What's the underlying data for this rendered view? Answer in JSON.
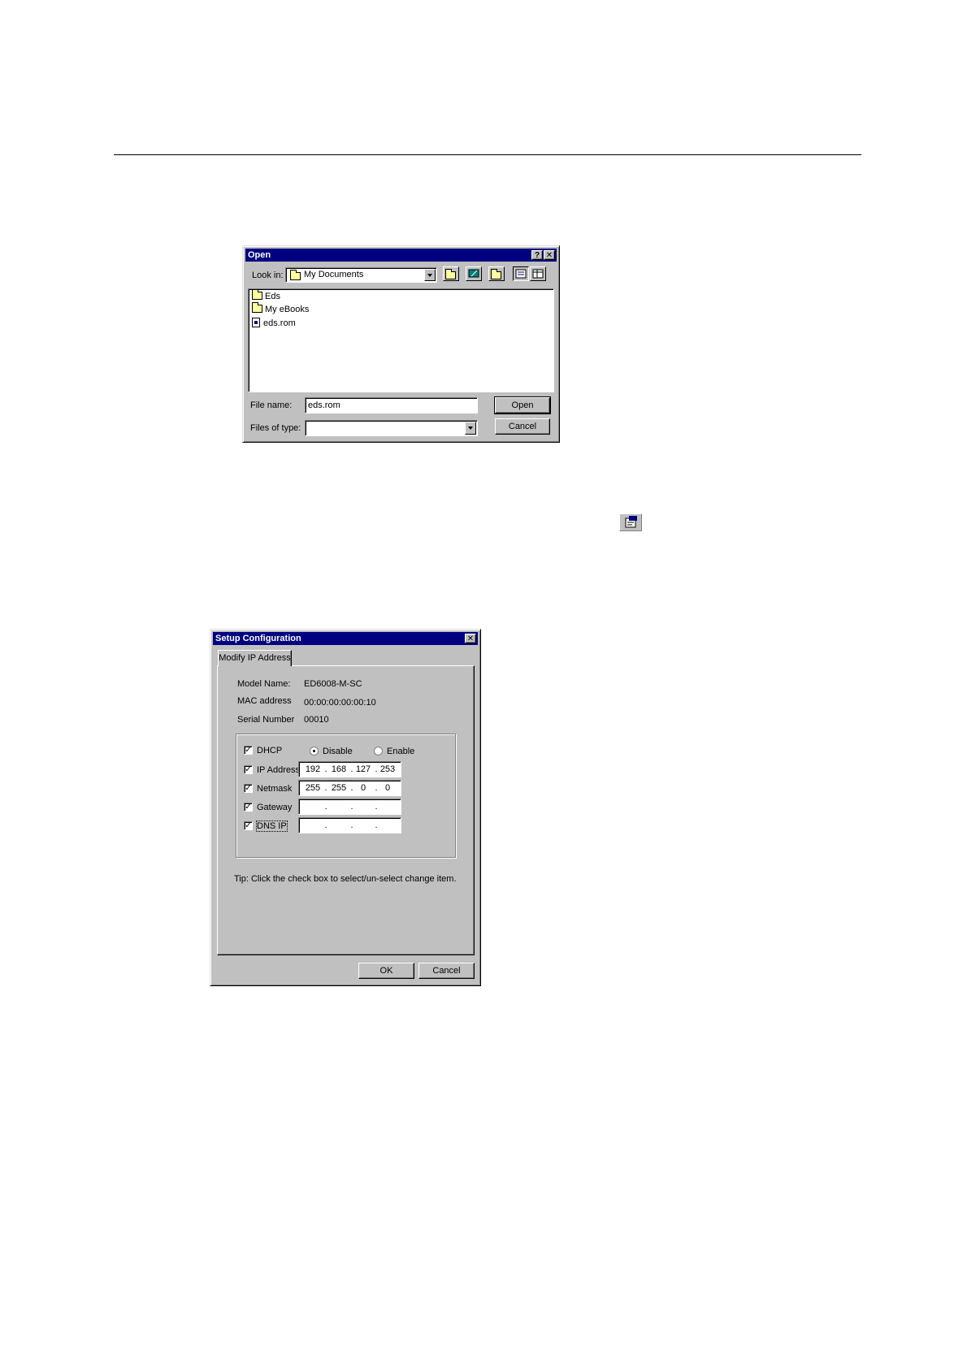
{
  "open_dialog": {
    "title": "Open",
    "help_btn": "?",
    "close_btn": "✕",
    "look_in_label": "Look in:",
    "look_in_value": "My Documents",
    "files": [
      {
        "name": "Eds",
        "icon": "folder-icon"
      },
      {
        "name": "My eBooks",
        "icon": "folder-icon"
      },
      {
        "name": "eds.rom",
        "icon": "file-icon"
      }
    ],
    "file_name_label": "File name:",
    "file_name_value": "eds.rom",
    "files_of_type_label": "Files of type:",
    "files_of_type_value": "",
    "open_button": "Open",
    "cancel_button": "Cancel"
  },
  "setup_dialog": {
    "title": "Setup Configuration",
    "close_btn": "✕",
    "tab_label": "Modify IP Address",
    "model_name_label": "Model Name:",
    "model_name_value": "ED6008-M-SC",
    "mac_label": "MAC address",
    "mac_value": "00:00:00:00:00:10",
    "serial_label": "Serial Number",
    "serial_value": "00010",
    "dhcp_label": "DHCP",
    "dhcp_disable": "Disable",
    "dhcp_enable": "Enable",
    "ip_label": "IP Address",
    "ip": [
      "192",
      "168",
      "127",
      "253"
    ],
    "netmask_label": "Netmask",
    "netmask": [
      "255",
      "255",
      "0",
      "0"
    ],
    "gateway_label": "Gateway",
    "dns_label": "DNS IP",
    "check_mark": "✓",
    "tip": "Tip: Click the check box to select/un-select change item.",
    "ok_button": "OK",
    "cancel_button": "Cancel"
  },
  "colors": {
    "titlebar": "#000080",
    "face": "#c0c0c0"
  }
}
